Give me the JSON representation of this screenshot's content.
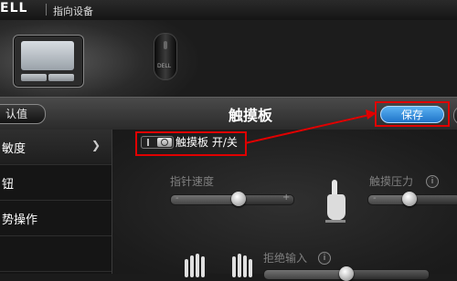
{
  "window": {
    "brand_logo": "ELL",
    "title": "指向设备"
  },
  "devices": {
    "touchpad_logo": "",
    "mouse_logo": "DELL"
  },
  "header": {
    "default_label": "认值",
    "page_title": "触摸板",
    "save_label": "保存"
  },
  "sidebar": {
    "items": [
      {
        "label": "敏度",
        "active": true
      },
      {
        "label": "钮"
      },
      {
        "label": "势操作"
      },
      {
        "label": ""
      }
    ]
  },
  "main": {
    "toggle_label": "触摸板 开/关",
    "pointer_speed": {
      "label": "指针速度",
      "minus": "-",
      "plus": "+",
      "value": 0.55
    },
    "touch_pressure": {
      "label": "触摸压力",
      "minus": "-",
      "value": 0.45
    },
    "palm_rejection": {
      "label": "拒绝输入",
      "value": 0.5
    },
    "help": "i"
  },
  "colors": {
    "highlight": "#e00000",
    "save_button": "#2f8be0"
  }
}
